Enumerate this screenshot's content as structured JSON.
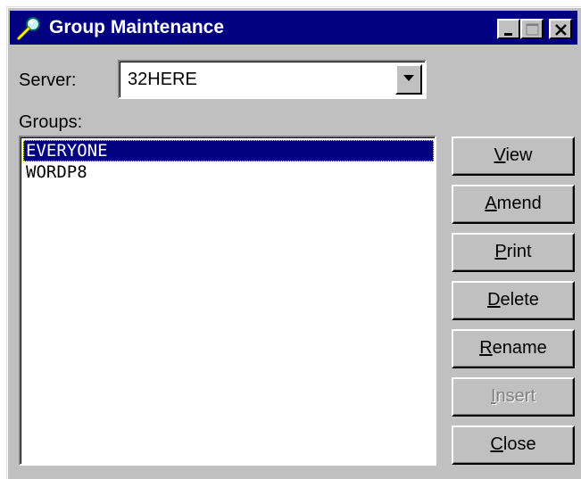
{
  "window": {
    "title": "Group Maintenance"
  },
  "icons": {
    "app": "magnifier-key-icon",
    "minimize": "minimize-icon",
    "maximize": "maximize-icon",
    "close": "close-x-icon",
    "dropdown": "chevron-down-icon"
  },
  "server": {
    "label": "Server:",
    "value": "32HERE"
  },
  "groups": {
    "label": "Groups:",
    "items": [
      "EVERYONE",
      "WORDP8"
    ],
    "selected": "EVERYONE"
  },
  "buttons": [
    {
      "accel": "V",
      "rest": "iew",
      "enabled": true
    },
    {
      "accel": "A",
      "rest": "mend",
      "enabled": true
    },
    {
      "accel": "P",
      "rest": "rint",
      "enabled": true
    },
    {
      "accel": "D",
      "rest": "elete",
      "enabled": true
    },
    {
      "accel": "R",
      "rest": "ename",
      "enabled": true
    },
    {
      "accel": "I",
      "rest": "nsert",
      "enabled": false
    },
    {
      "accel": "C",
      "rest": "lose",
      "enabled": true
    }
  ],
  "colors": {
    "titlebar": "#000080",
    "face": "#c0c0c0",
    "selection": "#000080"
  }
}
